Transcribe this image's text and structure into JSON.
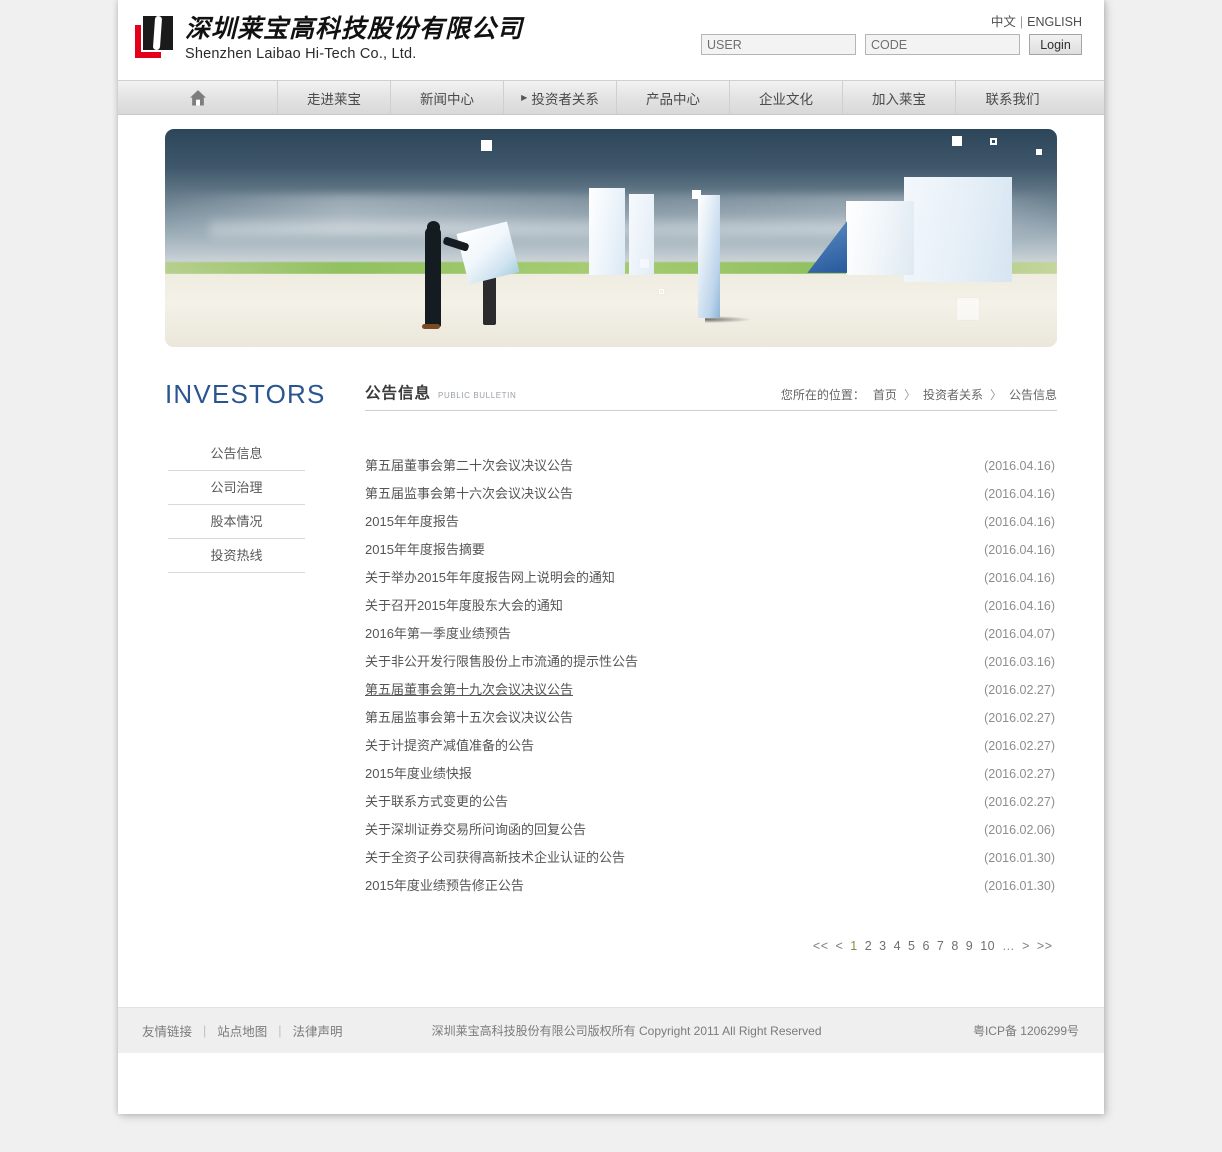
{
  "header": {
    "logo": {
      "cn": "深圳莱宝高科技股份有限公司",
      "en": "Shenzhen Laibao Hi-Tech Co., Ltd.",
      "mark_colors": {
        "red": "#e2001a",
        "black": "#1a1a1a"
      }
    },
    "lang": {
      "cn": "中文",
      "separator": "|",
      "en": "ENGLISH"
    },
    "login": {
      "user_placeholder": "USER",
      "user_value": "",
      "code_placeholder": "CODE",
      "code_value": "",
      "button_label": "Login"
    }
  },
  "nav": {
    "home_icon": "home-icon",
    "items": [
      {
        "label": "走进莱宝",
        "active": false
      },
      {
        "label": "新闻中心",
        "active": false
      },
      {
        "label": "投资者关系",
        "active": true
      },
      {
        "label": "产品中心",
        "active": false
      },
      {
        "label": "企业文化",
        "active": false
      },
      {
        "label": "加入莱宝",
        "active": false
      },
      {
        "label": "联系我们",
        "active": false
      }
    ]
  },
  "banner": {
    "alt": "banner-businessmen-with-cubes"
  },
  "section": {
    "side_heading": "INVESTORS",
    "title_cn": "公告信息",
    "title_en": "PUBLIC BULLETIN",
    "accent_color": "#2a5591"
  },
  "breadcrumb": {
    "lead": "您所在的位置：",
    "items": [
      "首页",
      "投资者关系",
      "公告信息"
    ],
    "separator": "〉"
  },
  "sidebar": {
    "items": [
      {
        "label": "公告信息"
      },
      {
        "label": "公司治理"
      },
      {
        "label": "股本情况"
      },
      {
        "label": "投资热线"
      }
    ]
  },
  "list": {
    "rows": [
      {
        "title": "第五届董事会第二十次会议决议公告",
        "date": "(2016.04.16)",
        "visited": false
      },
      {
        "title": "第五届监事会第十六次会议决议公告",
        "date": "(2016.04.16)",
        "visited": false
      },
      {
        "title": "2015年年度报告",
        "date": "(2016.04.16)",
        "visited": false
      },
      {
        "title": "2015年年度报告摘要",
        "date": "(2016.04.16)",
        "visited": false
      },
      {
        "title": "关于举办2015年年度报告网上说明会的通知",
        "date": "(2016.04.16)",
        "visited": false
      },
      {
        "title": "关于召开2015年度股东大会的通知",
        "date": "(2016.04.16)",
        "visited": false
      },
      {
        "title": "2016年第一季度业绩预告",
        "date": "(2016.04.07)",
        "visited": false
      },
      {
        "title": "关于非公开发行限售股份上市流通的提示性公告",
        "date": "(2016.03.16)",
        "visited": false
      },
      {
        "title": "第五届董事会第十九次会议决议公告",
        "date": "(2016.02.27)",
        "visited": true
      },
      {
        "title": "第五届监事会第十五次会议决议公告",
        "date": "(2016.02.27)",
        "visited": false
      },
      {
        "title": "关于计提资产减值准备的公告",
        "date": "(2016.02.27)",
        "visited": false
      },
      {
        "title": "2015年度业绩快报",
        "date": "(2016.02.27)",
        "visited": false
      },
      {
        "title": "关于联系方式变更的公告",
        "date": "(2016.02.27)",
        "visited": false
      },
      {
        "title": "关于深圳证券交易所问询函的回复公告",
        "date": "(2016.02.06)",
        "visited": false
      },
      {
        "title": "关于全资子公司获得高新技术企业认证的公告",
        "date": "(2016.01.30)",
        "visited": false
      },
      {
        "title": "2015年度业绩预告修正公告",
        "date": "(2016.01.30)",
        "visited": false
      }
    ]
  },
  "pagination": {
    "first": "<<",
    "prev": "<",
    "pages": [
      "1",
      "2",
      "3",
      "4",
      "5",
      "6",
      "7",
      "8",
      "9",
      "10"
    ],
    "ellipsis": "…",
    "next": ">",
    "last": ">>",
    "current": "1",
    "current_color": "#8a8a3f"
  },
  "footer": {
    "links": [
      "友情链接",
      "站点地图",
      "法律声明"
    ],
    "separator": "|",
    "copyright": "深圳莱宝高科技股份有限公司版权所有 Copyright 2011 All Right Reserved",
    "icp": "粤ICP备 1206299号"
  }
}
